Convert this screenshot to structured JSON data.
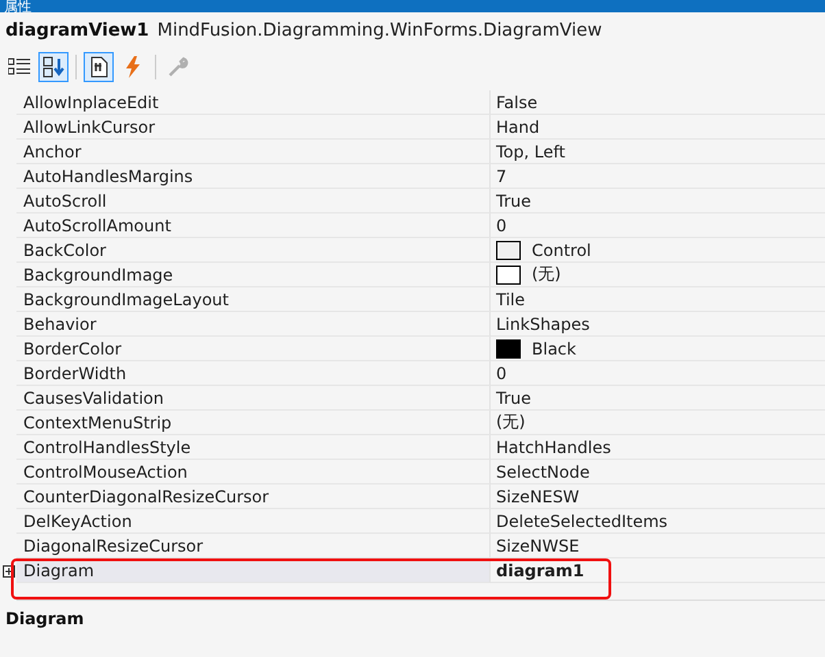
{
  "window": {
    "title": "属性"
  },
  "object": {
    "name": "diagramView1",
    "type": "MindFusion.Diagramming.WinForms.DiagramView"
  },
  "toolbar": [
    {
      "kind": "categorized",
      "selected": false
    },
    {
      "kind": "alphabetical",
      "selected": true
    },
    {
      "kind": "properties",
      "selected": true
    },
    {
      "kind": "events",
      "selected": false
    },
    {
      "kind": "pages",
      "selected": false,
      "disabled": true
    }
  ],
  "properties": [
    {
      "name": "AllowInplaceEdit",
      "value": "False",
      "selected": false,
      "modified": false,
      "expandable": false
    },
    {
      "name": "AllowLinkCursor",
      "value": "Hand",
      "selected": false,
      "modified": false,
      "expandable": false
    },
    {
      "name": "Anchor",
      "value": "Top, Left",
      "selected": false,
      "modified": false,
      "expandable": false
    },
    {
      "name": "AutoHandlesMargins",
      "value": "7",
      "selected": false,
      "modified": false,
      "expandable": false
    },
    {
      "name": "AutoScroll",
      "value": "True",
      "selected": false,
      "modified": false,
      "expandable": false
    },
    {
      "name": "AutoScrollAmount",
      "value": "0",
      "selected": false,
      "modified": false,
      "expandable": false
    },
    {
      "name": "BackColor",
      "value": "Control",
      "color": "#f0f0f0",
      "selected": false,
      "modified": false,
      "expandable": false
    },
    {
      "name": "BackgroundImage",
      "value": "(无)",
      "color": "#ffffff",
      "selected": false,
      "modified": false,
      "expandable": false
    },
    {
      "name": "BackgroundImageLayout",
      "value": "Tile",
      "selected": false,
      "modified": false,
      "expandable": false
    },
    {
      "name": "Behavior",
      "value": "LinkShapes",
      "selected": false,
      "modified": false,
      "expandable": false
    },
    {
      "name": "BorderColor",
      "value": "Black",
      "color": "#000000",
      "selected": false,
      "modified": false,
      "expandable": false
    },
    {
      "name": "BorderWidth",
      "value": "0",
      "selected": false,
      "modified": false,
      "expandable": false
    },
    {
      "name": "CausesValidation",
      "value": "True",
      "selected": false,
      "modified": false,
      "expandable": false
    },
    {
      "name": "ContextMenuStrip",
      "value": "(无)",
      "selected": false,
      "modified": false,
      "expandable": false
    },
    {
      "name": "ControlHandlesStyle",
      "value": "HatchHandles",
      "selected": false,
      "modified": false,
      "expandable": false
    },
    {
      "name": "ControlMouseAction",
      "value": "SelectNode",
      "selected": false,
      "modified": false,
      "expandable": false
    },
    {
      "name": "CounterDiagonalResizeCursor",
      "value": "SizeNESW",
      "selected": false,
      "modified": false,
      "expandable": false
    },
    {
      "name": "DelKeyAction",
      "value": "DeleteSelectedItems",
      "selected": false,
      "modified": false,
      "expandable": false
    },
    {
      "name": "DiagonalResizeCursor",
      "value": "SizeNWSE",
      "selected": false,
      "modified": false,
      "expandable": false
    },
    {
      "name": "Diagram",
      "value": "diagram1",
      "selected": true,
      "modified": true,
      "expandable": true,
      "highlighted": true
    }
  ],
  "description": {
    "title": "Diagram"
  }
}
